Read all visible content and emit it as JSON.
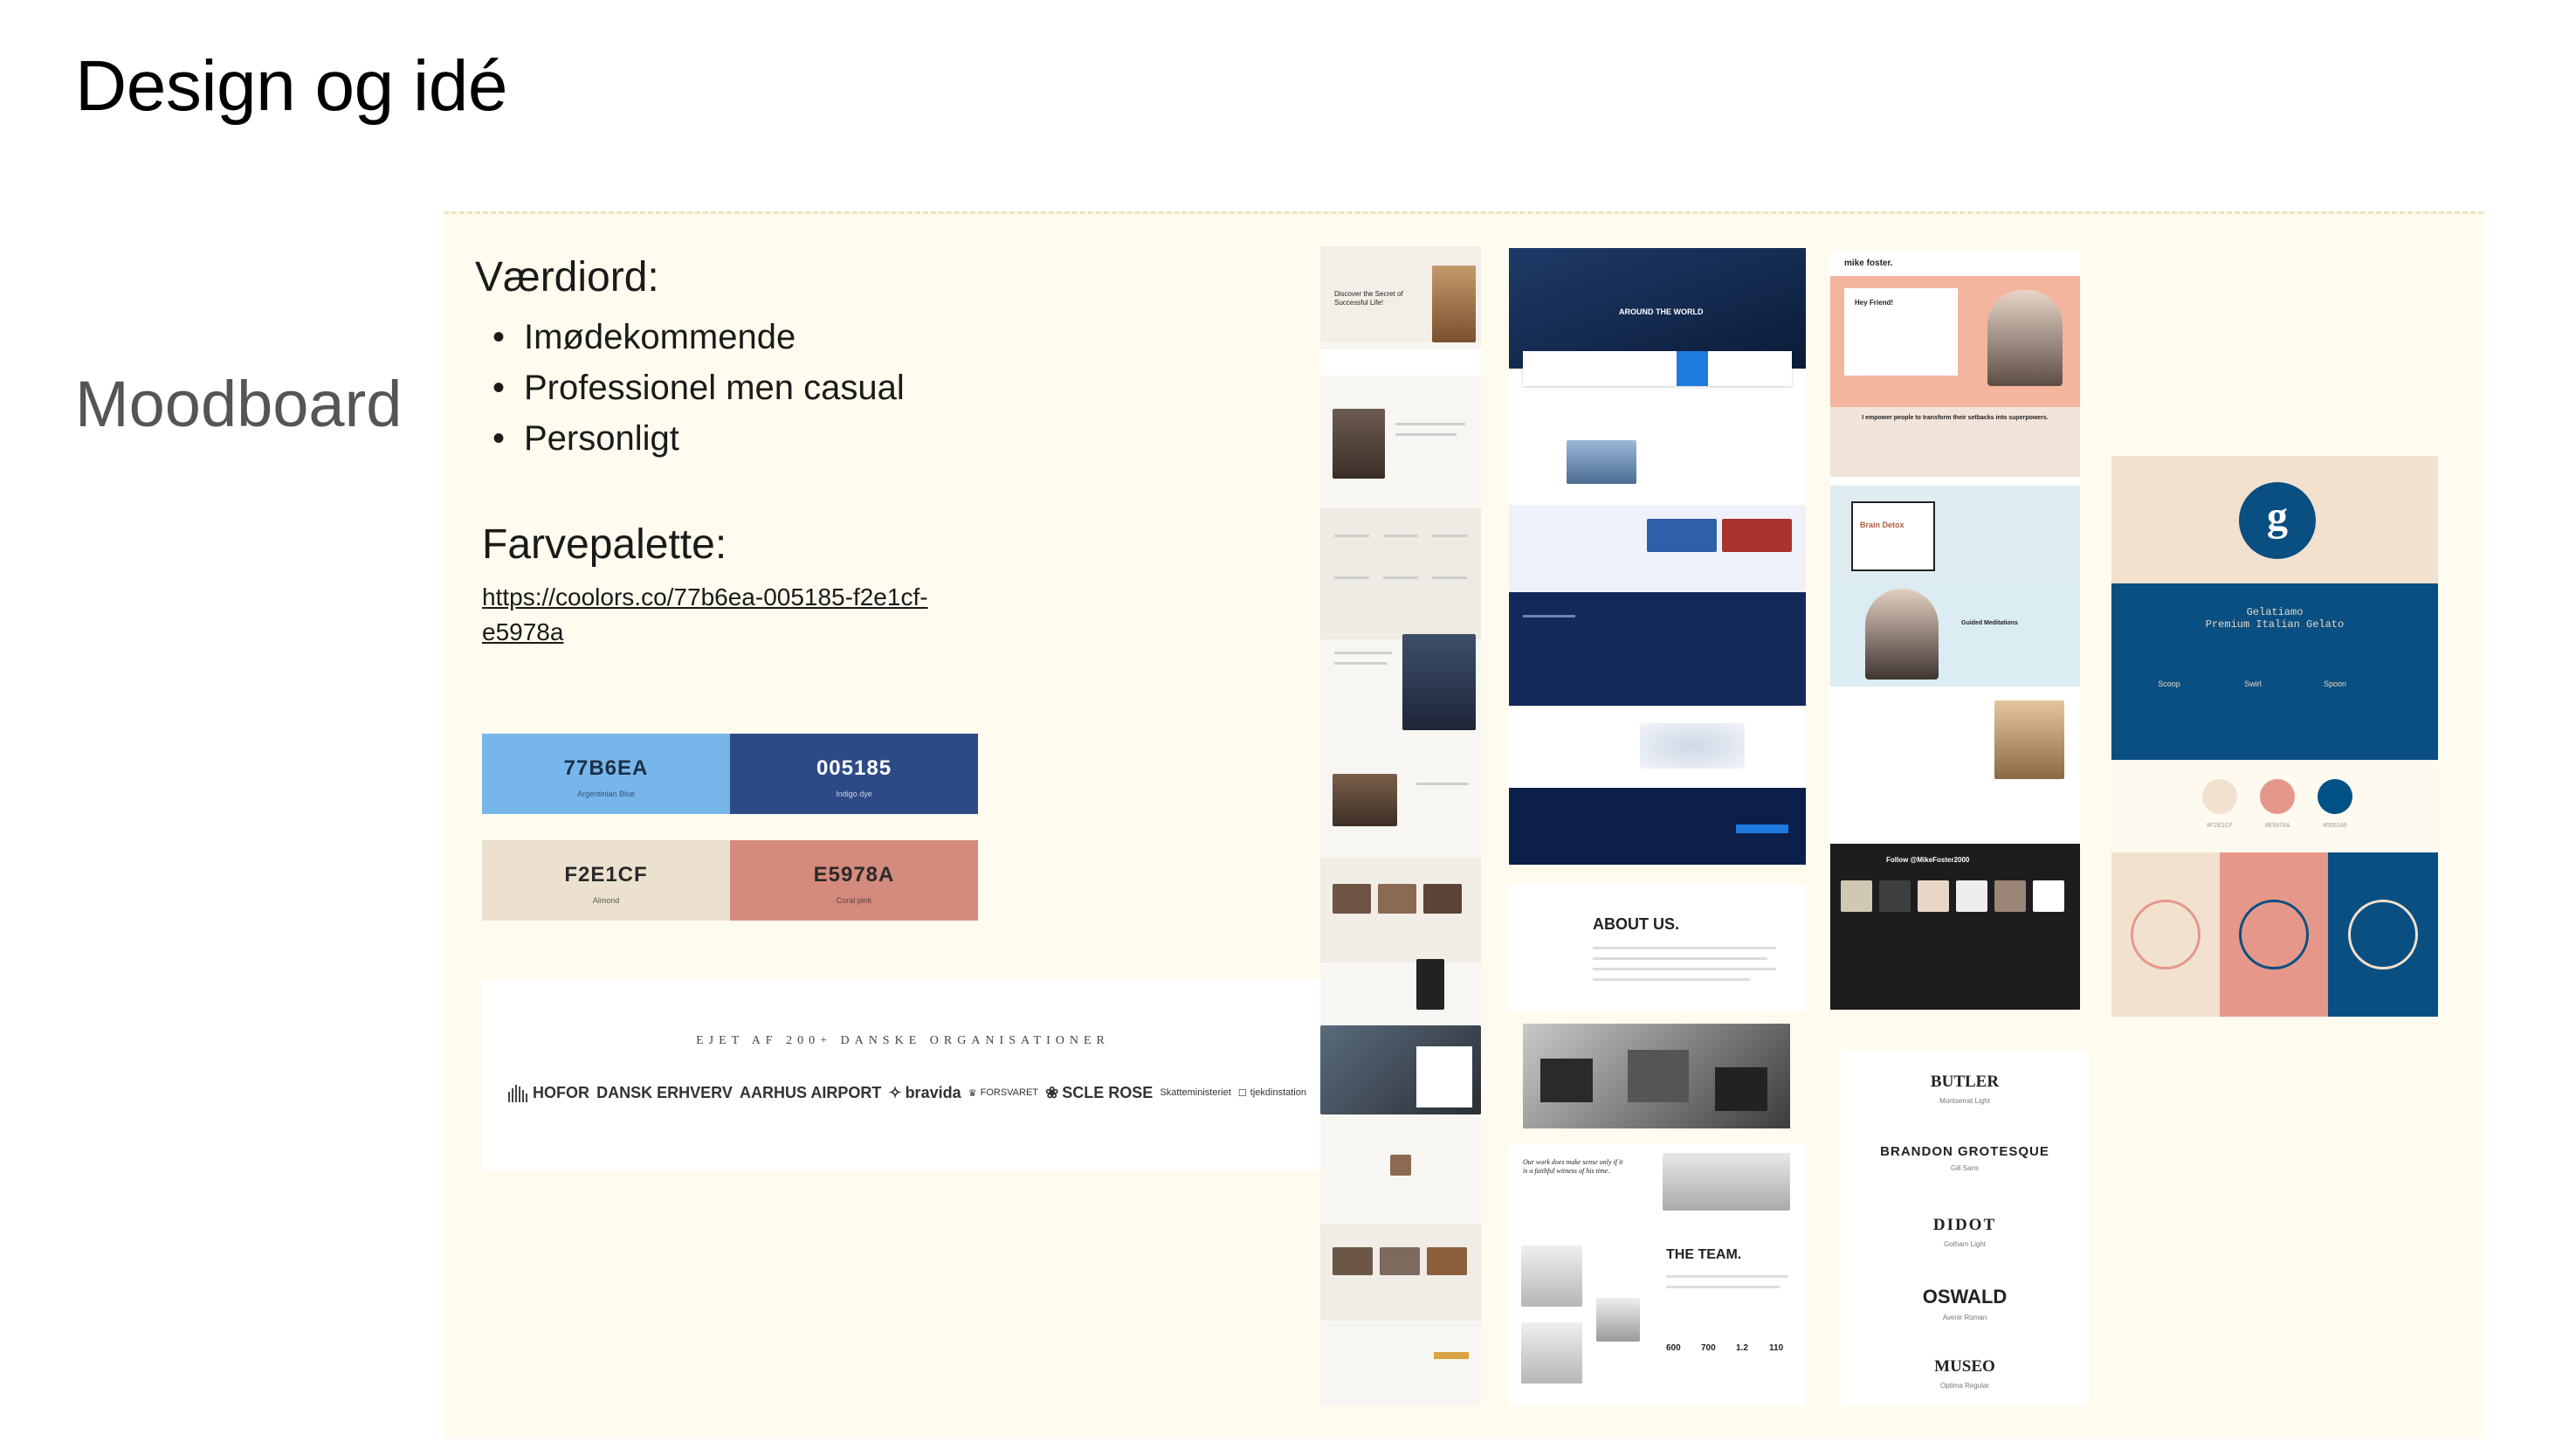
{
  "slide": {
    "title": "Design og idé",
    "section_label": "Moodboard"
  },
  "values": {
    "heading": "Værdiord:",
    "items": [
      "Imødekommende",
      "Professionel men casual",
      "Personligt"
    ]
  },
  "palette": {
    "heading": "Farvepalette:",
    "link": "https://coolors.co/77b6ea-005185-f2e1cf-e5978a",
    "swatches": [
      {
        "hex": "77B6EA",
        "name": "Argentinian Blue",
        "color": "#77b6ea",
        "text_color": "#1c2f48"
      },
      {
        "hex": "005185",
        "name": "Indigo dye",
        "color": "#2e4a86",
        "text_color": "#ffffff"
      },
      {
        "hex": "F2E1CF",
        "name": "Almond",
        "color": "#ece0cf",
        "text_color": "#2a2a2a"
      },
      {
        "hex": "E5978A",
        "name": "Coral pink",
        "color": "#d48a7c",
        "text_color": "#2a2a2a"
      }
    ]
  },
  "organisations": {
    "heading": "EJET AF 200+ DANSKE ORGANISATIONER",
    "logos": [
      "HOFOR",
      "DANSK ERHVERV",
      "AARHUS AIRPORT",
      "bravida",
      "FORSVARET",
      "SCLE ROSE",
      "Skatteministeriet",
      "tjekdinstation"
    ]
  },
  "screens": {
    "coach_hero": "Discover the Secret of Successful Life!",
    "brainstorm_heading": "AROUND THE WORLD",
    "mike_brand": "mike foster.",
    "mike_hello": "Hey Friend!",
    "mike_tagline": "I empower people to transform their setbacks into superpowers.",
    "mike_brain": "Brain Detox",
    "mike_meditation": "Guided Meditations",
    "mike_follow": "Follow @MikeFoster2000",
    "about_heading": "ABOUT US.",
    "team_heading": "THE TEAM.",
    "team_stats": [
      "600",
      "700",
      "1.2",
      "110"
    ],
    "quote": "Our work does make sense only if it is a faithful witness of his time."
  },
  "gelato": {
    "name": "Gelatiamo",
    "tagline": "Premium Italian Gelato",
    "steps": [
      "Scoop",
      "Swirl",
      "Spoon"
    ],
    "colors": [
      "#f2e1cf",
      "#e5978a",
      "#005185"
    ],
    "color_labels": [
      "#F2E1CF",
      "#E5978A",
      "#005185"
    ]
  },
  "typography": {
    "fonts": [
      {
        "name": "BUTLER",
        "sub": "Montserrat Light"
      },
      {
        "name": "BRANDON GROTESQUE",
        "sub": "Gill Sans"
      },
      {
        "name": "DIDOT",
        "sub": "Gotham Light"
      },
      {
        "name": "OSWALD",
        "sub": "Avenir Roman"
      },
      {
        "name": "MUSEO",
        "sub": "Optima Regular"
      }
    ]
  }
}
